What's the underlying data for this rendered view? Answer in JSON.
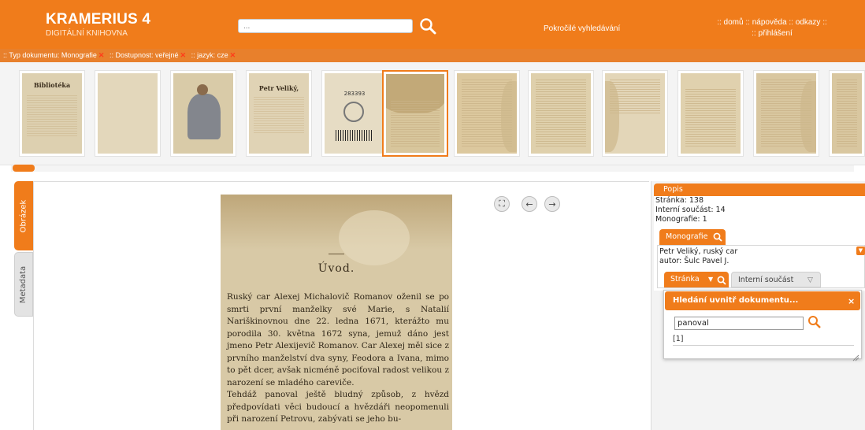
{
  "header": {
    "title": "KRAMERIUS 4",
    "subtitle": "DIGITÁLNÍ KNIHOVNA",
    "search_placeholder": "...",
    "advanced_search": "Pokročilé vyhledávání",
    "links": [
      ":: domů",
      ":: nápověda",
      ":: odkazy ::"
    ],
    "login": ":: přihlášení"
  },
  "filters": [
    {
      "label": ":: Typ dokumentu: Monografie"
    },
    {
      "label": ":: Dostupnost: veřejné"
    },
    {
      "label": ":: jazyk: cze"
    }
  ],
  "thumbnails": {
    "selected_index": 5,
    "cover_title": "Bibliotéka",
    "title_page_title": "Petr Veliký,",
    "stamp_number": "283393"
  },
  "side_tabs": {
    "image": "Obrázek",
    "metadata": "Metadata"
  },
  "page": {
    "heading": "Úvod.",
    "text": "Ruský car Alexej Michalovič Romanov oženil se po smrti první manželky své Marie, s Natalií Nariškinovnou dne 22. ledna 1671, kterážto mu porodila 30. května 1672 syna, jemuž dáno jest jmeno Petr Alexijevič Romanov. Car Alexej měl sice z prvního manželství dva syny, Feodora a Ivana, mimo to pět dcer, avšak nicméně pociťoval radost velikou z narození se mladého careviče.\n      Tehdáž panoval ještě bludný způsob, z hvězd předpovídati věci budoucí a hvězdáři neopomenuli při narození Petrovu, zabývati se jeho bu-"
  },
  "right_panel": {
    "header": "Popis",
    "page_label": "Stránka: 138",
    "internal_part_label": "Interní součást: 14",
    "monograph_label": "Monografie: 1",
    "tab_monograph": "Monografie",
    "mono_title": "Petr Veliký, ruský car",
    "mono_author": "autor: Šulc Pavel J.",
    "tab_page": "Stránka",
    "tab_internal_part": "Interní součást"
  },
  "search_dialog": {
    "title": "Hledání uvnitř dokumentu...",
    "close": "×",
    "query": "panoval",
    "result": "[1]"
  },
  "colors": {
    "accent": "#f07c1b",
    "filter_bar": "#e8802c",
    "remove_x": "#ff3b1a"
  }
}
